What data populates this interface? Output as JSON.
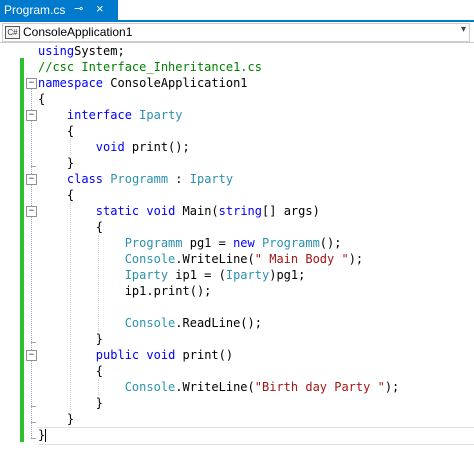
{
  "tab": {
    "filename": "Program.cs",
    "pin_glyph": "⊸",
    "close_glyph": "×"
  },
  "navbar": {
    "project_icon_text": "C#",
    "project": "ConsoleApplication1",
    "dropdown_glyph": "▾"
  },
  "editor": {
    "code_lines": [
      [
        [
          "kw",
          "using"
        ],
        [
          "",
          "System;"
        ]
      ],
      [
        [
          "cm",
          "//csc Interface_Inheritance1.cs"
        ]
      ],
      [
        [
          "kw",
          "namespace"
        ],
        [
          "",
          " ConsoleApplication1"
        ]
      ],
      [
        [
          "",
          "{"
        ]
      ],
      [
        [
          "",
          "    "
        ],
        [
          "kw",
          "interface"
        ],
        [
          "",
          " "
        ],
        [
          "ty",
          "Iparty"
        ]
      ],
      [
        [
          "",
          "    {"
        ]
      ],
      [
        [
          "",
          "        "
        ],
        [
          "kw",
          "void"
        ],
        [
          "",
          " print();"
        ]
      ],
      [
        [
          "",
          "    }"
        ]
      ],
      [
        [
          "",
          "    "
        ],
        [
          "kw",
          "class"
        ],
        [
          "",
          " "
        ],
        [
          "ty",
          "Programm"
        ],
        [
          "",
          " : "
        ],
        [
          "ty",
          "Iparty"
        ]
      ],
      [
        [
          "",
          "    {"
        ]
      ],
      [
        [
          "",
          "        "
        ],
        [
          "kw",
          "static"
        ],
        [
          "",
          " "
        ],
        [
          "kw",
          "void"
        ],
        [
          "",
          " Main("
        ],
        [
          "kw",
          "string"
        ],
        [
          "",
          "[] args)"
        ]
      ],
      [
        [
          "",
          "        {"
        ]
      ],
      [
        [
          "",
          "            "
        ],
        [
          "ty",
          "Programm"
        ],
        [
          "",
          " pg1 = "
        ],
        [
          "kw",
          "new"
        ],
        [
          "",
          " "
        ],
        [
          "ty",
          "Programm"
        ],
        [
          "",
          "();"
        ]
      ],
      [
        [
          "",
          "            "
        ],
        [
          "ty",
          "Console"
        ],
        [
          "",
          ".WriteLine("
        ],
        [
          "str",
          "\" Main Body \""
        ],
        [
          "",
          ");"
        ]
      ],
      [
        [
          "",
          "            "
        ],
        [
          "ty",
          "Iparty"
        ],
        [
          "",
          " ip1 = ("
        ],
        [
          "ty",
          "Iparty"
        ],
        [
          "",
          ")pg1;"
        ]
      ],
      [
        [
          "",
          "            ip1.print();"
        ]
      ],
      [
        [
          "",
          ""
        ]
      ],
      [
        [
          "",
          "            "
        ],
        [
          "ty",
          "Console"
        ],
        [
          "",
          ".ReadLine();"
        ]
      ],
      [
        [
          "",
          "        }"
        ]
      ],
      [
        [
          "",
          "        "
        ],
        [
          "kw",
          "public"
        ],
        [
          "",
          " "
        ],
        [
          "kw",
          "void"
        ],
        [
          "",
          " print()"
        ]
      ],
      [
        [
          "",
          "        {"
        ]
      ],
      [
        [
          "",
          "            "
        ],
        [
          "ty",
          "Console"
        ],
        [
          "",
          ".WriteLine("
        ],
        [
          "str",
          "\"Birth day Party \""
        ],
        [
          "",
          ");"
        ]
      ],
      [
        [
          "",
          "        }"
        ]
      ],
      [
        [
          "",
          "    }"
        ]
      ],
      [
        [
          "",
          "}"
        ]
      ]
    ],
    "fold_glyph": "−"
  },
  "colors": {
    "tab_active": "#007acc",
    "keyword": "#0000ff",
    "type": "#2b91af",
    "string": "#a31515",
    "comment": "#008000",
    "change_bar": "#2cc12c"
  }
}
